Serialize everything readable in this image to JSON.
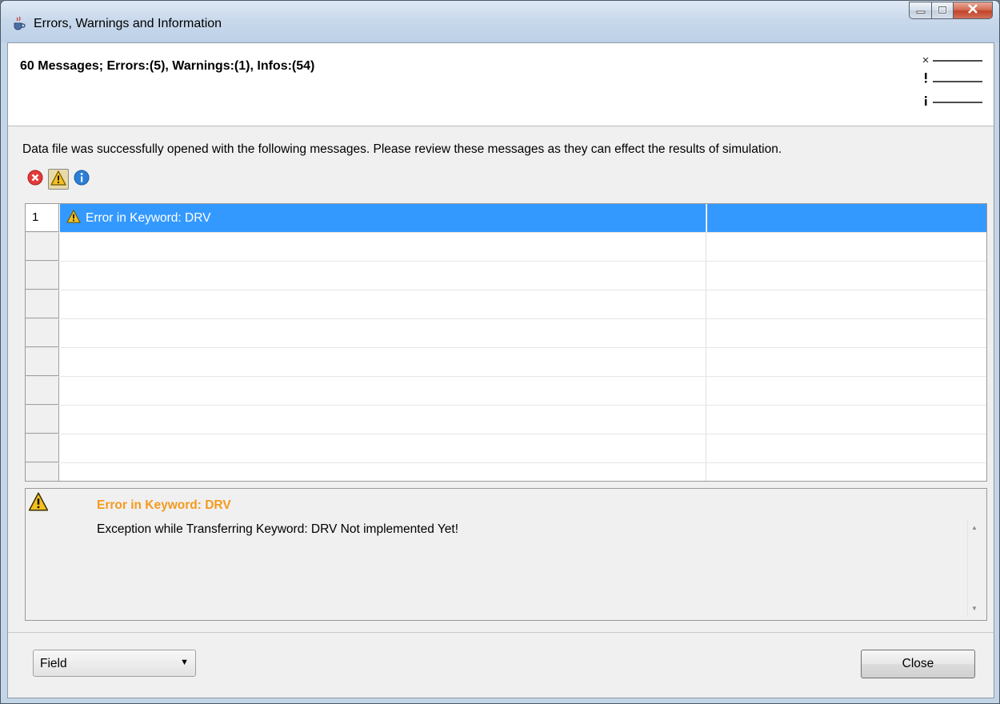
{
  "window": {
    "title": "Errors, Warnings and Information",
    "app_icon": "java-cup-icon",
    "caption_buttons": [
      "minimize-icon",
      "maximize-icon",
      "close-icon"
    ]
  },
  "header": {
    "summary": "60 Messages; Errors:(5), Warnings:(1), Infos:(54)",
    "decoration_icon": "message-list-icon"
  },
  "description": "Data file was successfully opened with the following messages. Please review these messages as they can effect the results of simulation.",
  "filters": [
    {
      "icon": "error-icon",
      "active": false
    },
    {
      "icon": "warning-icon",
      "active": true
    },
    {
      "icon": "info-icon",
      "active": false
    }
  ],
  "grid": {
    "rows": [
      {
        "number": "1",
        "icon": "warning-icon",
        "text": "Error in Keyword: DRV",
        "selected": true
      }
    ]
  },
  "detail": {
    "icon": "warning-icon",
    "title": "Error in Keyword: DRV",
    "message": "Exception while Transferring Keyword: DRV Not implemented Yet!"
  },
  "footer": {
    "dropdown_value": "Field",
    "close_label": "Close"
  },
  "colors": {
    "selection": "#3399ff",
    "detail_title": "#f39a1e",
    "error_red": "#e23b3b",
    "warning_yellow": "#f4c020",
    "info_blue": "#2b7fd6"
  }
}
